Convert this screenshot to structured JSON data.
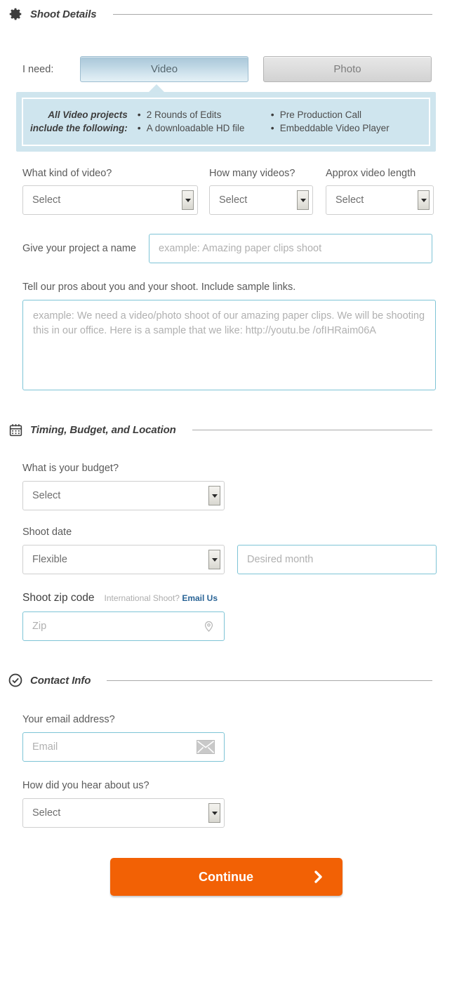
{
  "sections": {
    "shoot_details": {
      "title": "Shoot Details",
      "icon": "gear-icon"
    },
    "timing": {
      "title": "Timing, Budget, and Location",
      "icon": "calendar-icon"
    },
    "contact": {
      "title": "Contact Info",
      "icon": "check-circle-icon"
    }
  },
  "need": {
    "label": "I need:",
    "video_label": "Video",
    "photo_label": "Photo",
    "selected": "Video"
  },
  "callout": {
    "lead_line1": "All Video projects",
    "lead_line2": "include the following:",
    "col1": [
      "2 Rounds of Edits",
      "A downloadable HD file"
    ],
    "col2": [
      "Pre Production Call",
      "Embeddable Video Player"
    ]
  },
  "video_fields": {
    "kind_label": "What kind of video?",
    "kind_value": "Select",
    "count_label": "How many videos?",
    "count_value": "Select",
    "length_label": "Approx video length",
    "length_value": "Select"
  },
  "project": {
    "name_label": "Give your project a name",
    "name_placeholder": "example: Amazing paper clips shoot",
    "desc_label": "Tell our pros about you and your shoot. Include sample links.",
    "desc_placeholder": "example: We need a video/photo shoot of our amazing paper clips. We will be shooting this in our office. Here is a sample that we like: http://youtu.be /ofIHRaim06A"
  },
  "timing_fields": {
    "budget_label": "What is your budget?",
    "budget_value": "Select",
    "date_label": "Shoot date",
    "date_value": "Flexible",
    "month_placeholder": "Desired month",
    "zip_label": "Shoot zip code",
    "zip_note": "International Shoot?",
    "zip_link": "Email Us",
    "zip_placeholder": "Zip",
    "zip_icon": "location-pin-icon"
  },
  "contact_fields": {
    "email_label": "Your email address?",
    "email_placeholder": "Email",
    "email_icon": "envelope-icon",
    "hear_label": "How did you hear about us?",
    "hear_value": "Select"
  },
  "cta": {
    "label": "Continue",
    "icon": "chevron-right-icon"
  },
  "colors": {
    "accent_orange": "#f26105",
    "callout_blue": "#cfe5ee",
    "input_border_blue": "#7ec4d6",
    "link_blue": "#2a6496"
  }
}
